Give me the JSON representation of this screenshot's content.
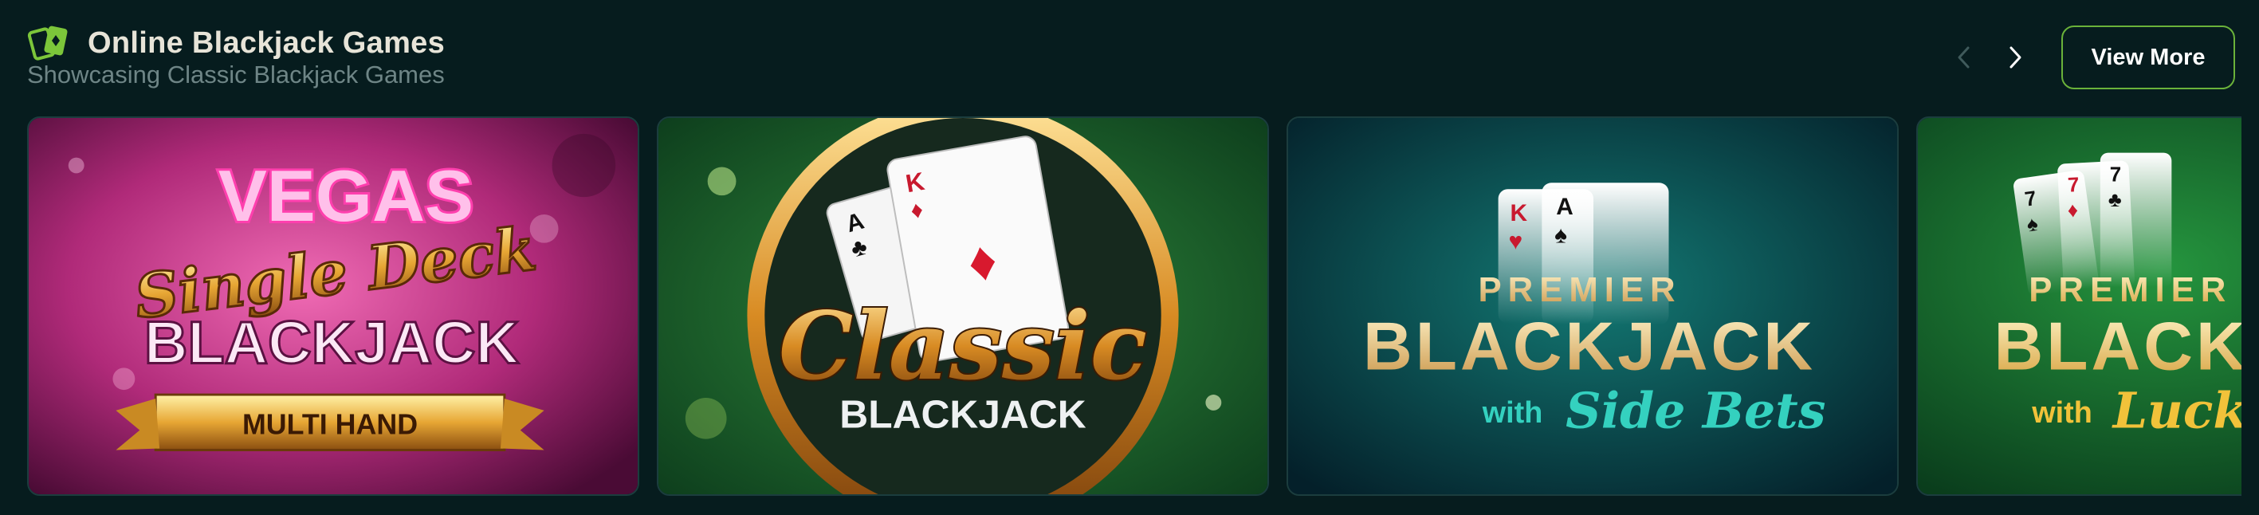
{
  "section": {
    "icon": "playing-cards-icon",
    "title": "Online Blackjack Games",
    "subtitle": "Showcasing Classic Blackjack Games",
    "prev_icon": "chevron-left-icon",
    "next_icon": "chevron-right-icon",
    "view_more_label": "View More",
    "accent_color": "#6ab23a"
  },
  "games": [
    {
      "title_line1": "VEGAS",
      "title_line2": "Single Deck",
      "title_line3": "BLACKJACK",
      "banner": "MULTI HAND"
    },
    {
      "card1_rank": "A",
      "card1_suit": "♣",
      "card2_rank": "K",
      "card2_suit": "♦",
      "title_script": "Classic",
      "title_sub": "BLACKJACK"
    },
    {
      "card1_rank": "K",
      "card1_suit": "♥",
      "card2_rank": "A",
      "card2_suit": "♠",
      "title_top": "PREMIER",
      "title_main": "BLACKJACK",
      "title_with": "with",
      "title_script": "Side Bets"
    },
    {
      "card1_rank": "7",
      "card1_suit": "♠",
      "card2_rank": "7",
      "card2_suit": "♦",
      "card3_rank": "7",
      "card3_suit": "♣",
      "title_top": "PREMIER",
      "title_main": "BLACKJACK",
      "title_with": "with",
      "title_script": "Lucky"
    }
  ]
}
